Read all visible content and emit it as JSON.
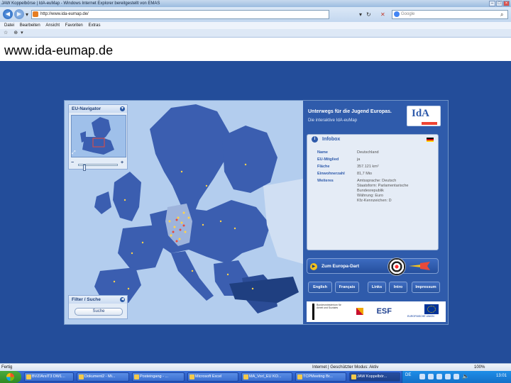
{
  "window": {
    "title": "JAW Koppelbörse | IdA-euMap - Windows Internet Explorer bereitgestellt von EMAS"
  },
  "browser": {
    "address": "http://www.ida-eumap.de/",
    "search_placeholder": "Google",
    "menu": [
      "Datei",
      "Bearbeiten",
      "Ansicht",
      "Favoriten",
      "Extras"
    ]
  },
  "site_heading": "www.ida-eumap.de",
  "app": {
    "navigator": {
      "title": "EU-Navigator",
      "zoom_level": 0.12
    },
    "filter": {
      "title": "Filter / Suche",
      "button": "Suche"
    },
    "header": {
      "title": "Unterwegs für die Jugend Europas.",
      "subtitle": "Die interaktive IdA-euMap",
      "logo_text": "IdA"
    },
    "infobox": {
      "title": "Infobox",
      "rows": [
        {
          "label": "Name",
          "value": "Deutschland"
        },
        {
          "label": "EU-Mitglied",
          "value": "ja"
        },
        {
          "label": "Fläche",
          "value": "357.121 km²"
        },
        {
          "label": "Einwohnerzahl",
          "value": "81,7 Mio"
        },
        {
          "label": "Weiteres",
          "value": "Amtssprache: Deutsch\nStaatsform: Parlamentarische\nBundesrepublik\nWährung: Euro\nKfz-Kennzeichen: D"
        }
      ]
    },
    "europa_button": "Zum Europa-Dart",
    "lang_buttons": [
      "English",
      "Français",
      "Links",
      "Intro",
      "Impressum"
    ],
    "logos": {
      "ministry": "Bundesministerium für Arbeit und Soziales",
      "esf": "ESF",
      "eu": "EUROPÄISCHE UNION"
    }
  },
  "status": {
    "left": "Fertig",
    "zone": "Internet | Geschützter Modus: Aktiv",
    "zoom": "100%"
  },
  "taskbar": {
    "items": [
      {
        "label": "BVZ/ArsIT3 DW1...",
        "active": false
      },
      {
        "label": "Dokument2 - Mi...",
        "active": false
      },
      {
        "label": "Posteingang - ...",
        "active": false
      },
      {
        "label": "Microsoft Excel",
        "active": false
      },
      {
        "label": "MA_Vorl_EU KO...",
        "active": false
      },
      {
        "label": "TCPMeeting Br...",
        "active": false
      },
      {
        "label": "JAW Koppelbör...",
        "active": true
      }
    ],
    "lang": "DE",
    "time": "13:01"
  }
}
